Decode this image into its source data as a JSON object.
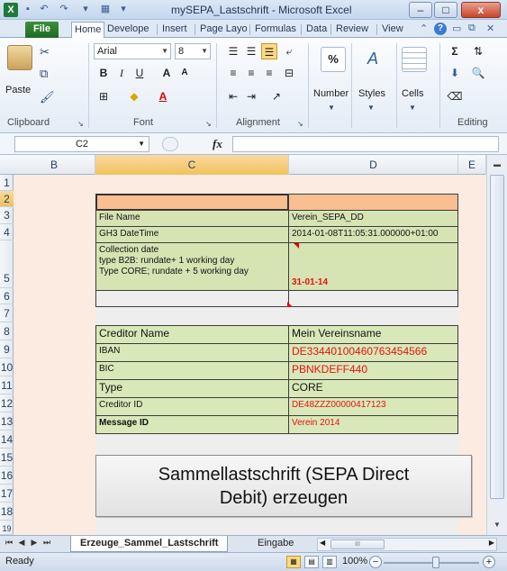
{
  "window": {
    "title": "mySEPA_Lastschrift - Microsoft Excel",
    "app_icon": "excel-icon",
    "minimize": "–",
    "maximize": "□",
    "close": "x"
  },
  "ribbon_tabs": {
    "file": "File",
    "home": "Home",
    "developer": "Develope",
    "insert": "Insert",
    "page_layout": "Page Layo",
    "formulas": "Formulas",
    "data": "Data",
    "review": "Review",
    "view": "View"
  },
  "ribbon": {
    "clipboard": {
      "label": "Clipboard",
      "paste": "Paste"
    },
    "font": {
      "label": "Font",
      "font_name": "Arial",
      "font_size": "8",
      "bold": "B",
      "italic": "I",
      "underline": "U",
      "grow": "A",
      "shrink": "A"
    },
    "alignment": {
      "label": "Alignment"
    },
    "number": {
      "label": "Number",
      "symbol": "%"
    },
    "styles": {
      "label": "Styles"
    },
    "cells": {
      "label": "Cells"
    },
    "editing": {
      "label": "Editing",
      "sum": "Σ"
    }
  },
  "formula_bar": {
    "name_box": "C2",
    "fx": "fx",
    "formula": ""
  },
  "columns": [
    "B",
    "C",
    "D",
    "E"
  ],
  "rows": [
    "1",
    "2",
    "3",
    "4",
    "5",
    "6",
    "7",
    "8",
    "9",
    "10",
    "11",
    "12",
    "13",
    "14",
    "15",
    "16",
    "17",
    "18",
    "19"
  ],
  "cells": {
    "C3": "File Name",
    "D3": "Verein_SEPA_DD",
    "C4": "GH3 DateTime",
    "D4": "2014-01-08T11:05:31.000000+01:00",
    "C5_line1": "Collection date",
    "C5_line2": "type B2B: rundate+ 1 working day",
    "C5_line3": "Type CORE; rundate + 5 working day",
    "D5": "31-01-14",
    "C8": "Creditor Name",
    "D8": "Mein Vereinsname",
    "C9": "IBAN",
    "D9": "DE33440100460763454566",
    "C10": "BIC",
    "D10": "PBNKDEFF440",
    "C11": "Type",
    "D11": "CORE",
    "C12": "Creditor ID",
    "D12": "DE48ZZZ00000417123",
    "C13": "Message ID",
    "D13": "Verein 2014"
  },
  "action_button": {
    "label_line1": "Sammellastschrift (SEPA Direct",
    "label_line2": "Debit) erzeugen"
  },
  "sheet_tabs": {
    "active": "Erzeuge_Sammel_Lastschrift",
    "next": "Eingabe"
  },
  "status": {
    "ready": "Ready",
    "zoom": "100%",
    "zoom_level_percent": 100
  },
  "colors": {
    "header_orange": "#f9be92",
    "data_green": "#d6e4b4",
    "red_text": "#e8120c",
    "sheet_background": "#fcebe1"
  }
}
